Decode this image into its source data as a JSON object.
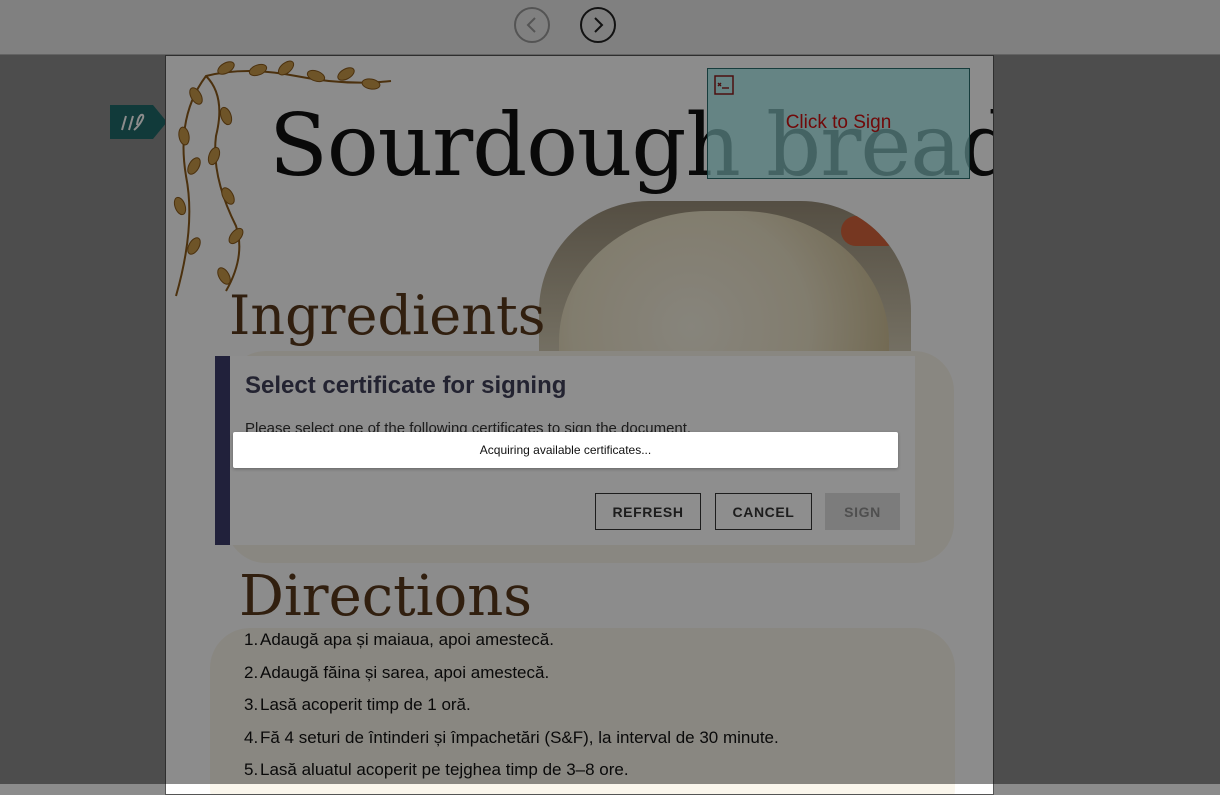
{
  "nav": {
    "prev_icon": "chevron-left-icon",
    "next_icon": "chevron-right-icon"
  },
  "document": {
    "title": "Sourdough bread",
    "ingredients_heading": "Ingredients",
    "directions_heading": "Directions",
    "directions": [
      {
        "num": "1.",
        "text": "Adaugă apa și maiaua, apoi amestecă."
      },
      {
        "num": "2.",
        "text": "Adaugă făina și sarea, apoi amestecă."
      },
      {
        "num": "3.",
        "text": "Lasă acoperit timp de 1 oră."
      },
      {
        "num": "4.",
        "text": "Fă 4 seturi de întinderi și împachetări (S&F), la interval de 30 minute."
      },
      {
        "num": "5.",
        "text": "Lasă aluatul acoperit pe tejghea timp de 3–8 ore."
      }
    ]
  },
  "signature_field": {
    "label": "Click to Sign",
    "icon": "signature-field-icon",
    "color": "#cc1111"
  },
  "sign_tag": {
    "icon": "pen-tag-icon",
    "color": "#1f6b6b"
  },
  "dialog": {
    "title": "Select certificate for signing",
    "message": "Please select one of the following certificates to sign the document.",
    "refresh_label": "REFRESH",
    "cancel_label": "CANCEL",
    "sign_label": "SIGN",
    "accent_color": "#3a3a66"
  },
  "loading": {
    "text": "Acquiring available certificates..."
  }
}
